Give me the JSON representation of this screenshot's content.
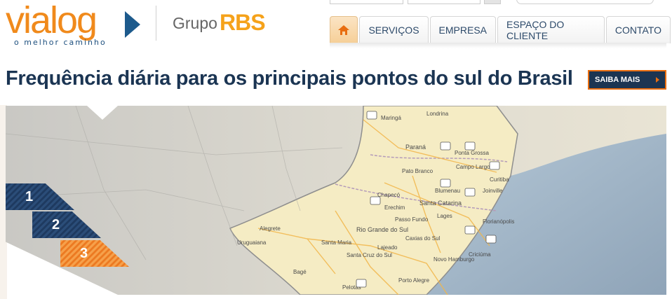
{
  "brand": {
    "logo_text": "vialog",
    "tagline": "o melhor caminho",
    "group_text": "Grupo",
    "group_brand": "RBS"
  },
  "nav": {
    "home_icon": "home-icon",
    "items": [
      {
        "label": "SERVIÇOS"
      },
      {
        "label": "EMPRESA"
      },
      {
        "label": "ESPAÇO DO CLIENTE"
      },
      {
        "label": "CONTATO"
      }
    ]
  },
  "hero": {
    "headline": "Frequência diária para os principais pontos do sul do Brasil",
    "cta_label": "SAIBA MAIS"
  },
  "slides": {
    "tabs": [
      {
        "label": "1",
        "active": false
      },
      {
        "label": "2",
        "active": false
      },
      {
        "label": "3",
        "active": true
      }
    ]
  },
  "map": {
    "cities": [
      "Londrina",
      "Maringá",
      "Paraná",
      "Ponta Grossa",
      "Pato Branco",
      "Campo Largo",
      "Curitiba",
      "Chapecó",
      "Joinville",
      "Blumenau",
      "Santa Catarina",
      "Erechim",
      "Lages",
      "Florianópolis",
      "Rio Grande do Sul",
      "Passo Fundo",
      "Alegrete",
      "Santa Maria",
      "Caxias do Sul",
      "Santa Cruz do Sul",
      "Lajeado",
      "Porto Alegre",
      "Novo Hamburgo",
      "Pelotas",
      "Criciúma",
      "Bagé",
      "Uruguaiana"
    ],
    "colors": {
      "land": "#f3eedd",
      "sea": "#a9bfd3",
      "state": "#f7e9b2",
      "road": "#f2c36b"
    }
  },
  "colors": {
    "brand_orange": "#f08a1c",
    "brand_blue": "#1d5a8c",
    "headline": "#1b3553",
    "cta_bg": "#1c3552",
    "cta_border": "#e86d10"
  }
}
